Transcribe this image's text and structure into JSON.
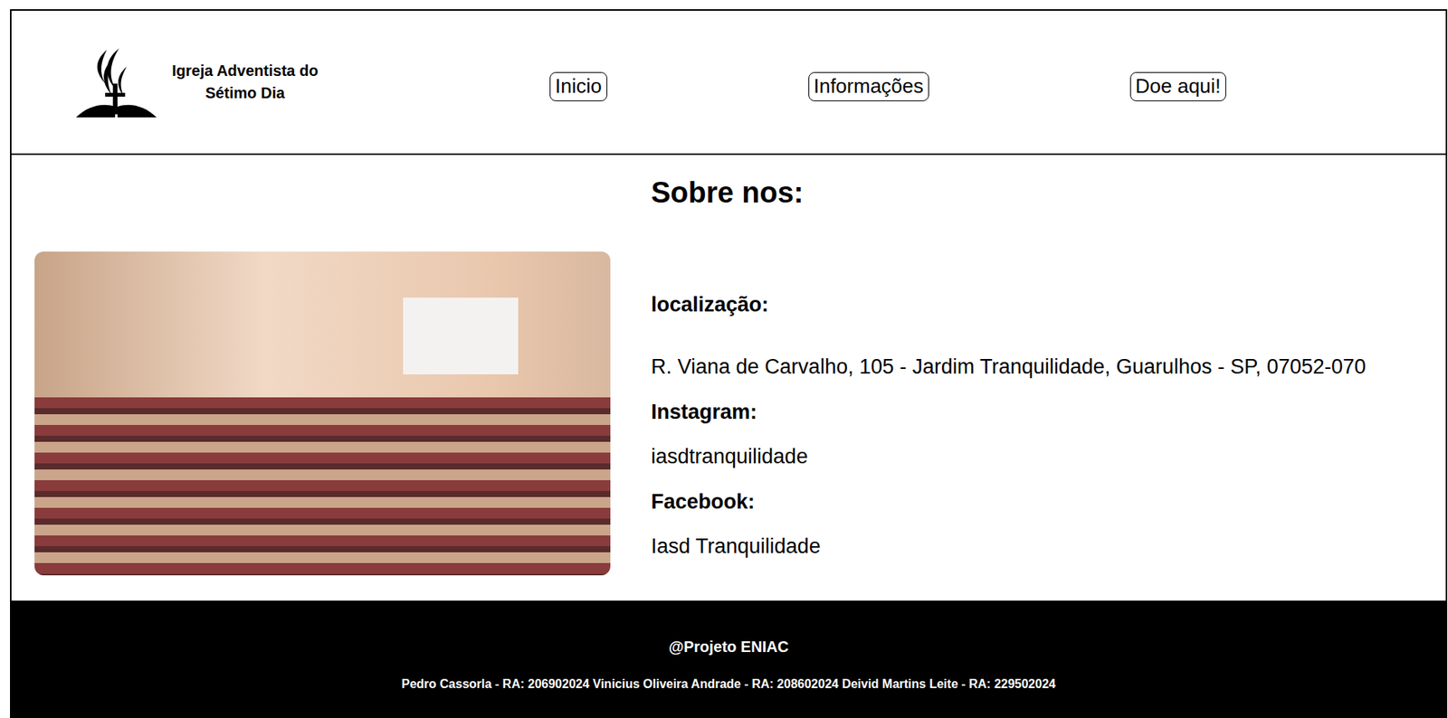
{
  "header": {
    "logo_text": [
      "Igreja Adventista do",
      "Sétimo Dia"
    ],
    "nav": [
      {
        "label": "Inicio"
      },
      {
        "label": "Informações"
      },
      {
        "label": "Doe aqui!"
      }
    ]
  },
  "about": {
    "heading": "Sobre nos:",
    "sections": [
      {
        "label": "localização:",
        "value": "R. Viana de Carvalho, 105 - Jardim Tranquilidade, Guarulhos - SP, 07052-070"
      },
      {
        "label": "Instagram:",
        "value": "iasdtranquilidade"
      },
      {
        "label": "Facebook:",
        "value": "Iasd Tranquilidade"
      }
    ]
  },
  "footer": {
    "title": "@Projeto ENIAC",
    "credits": "Pedro Cassorla - RA: 206902024 Vinicius Oliveira Andrade - RA: 208602024 Deivid Martins Leite - RA: 229502024"
  }
}
